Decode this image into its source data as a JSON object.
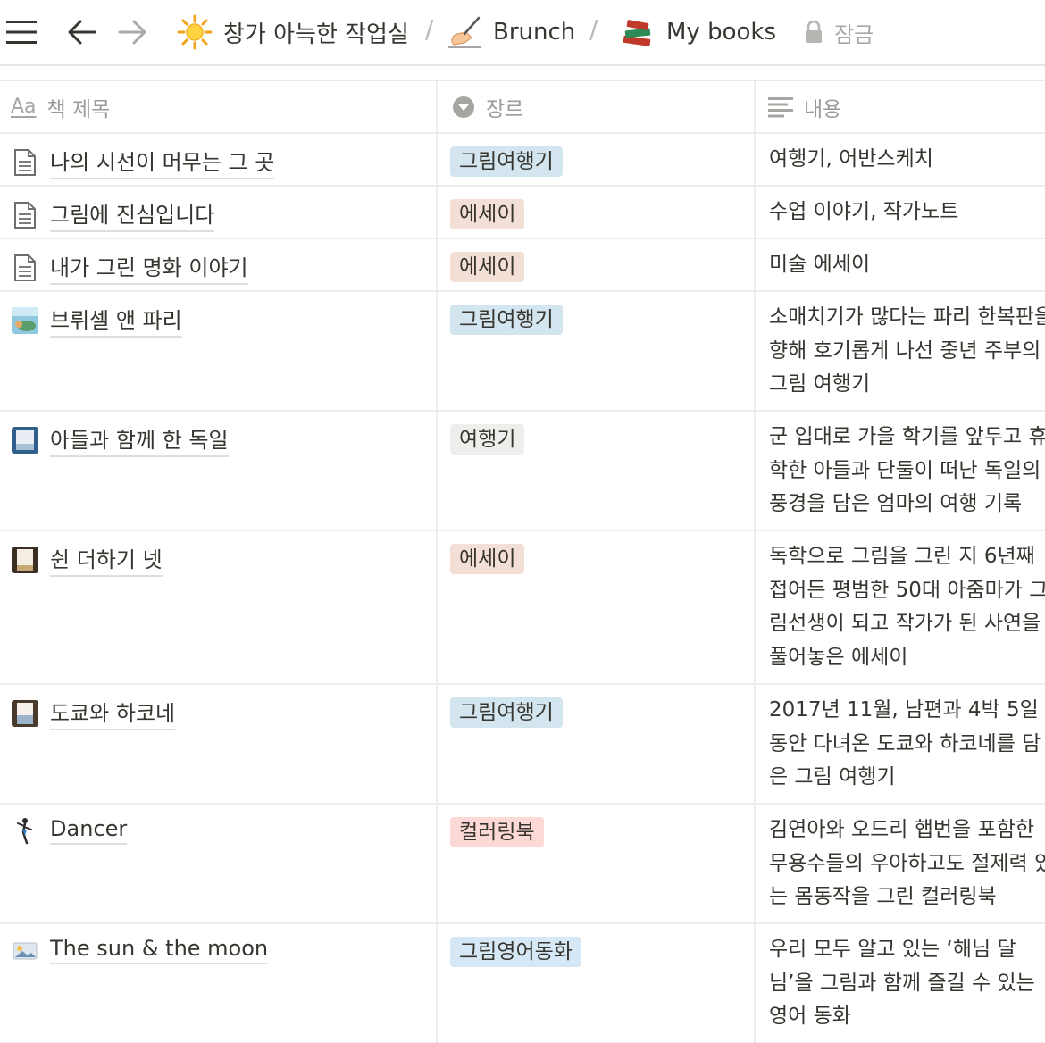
{
  "topbar": {
    "breadcrumbs": [
      {
        "label": "창가 아늑한 작업실",
        "icon": "sun-icon"
      },
      {
        "label": "Brunch",
        "icon": "writing-hand-icon"
      },
      {
        "label": "My books",
        "icon": "books-icon"
      }
    ],
    "separator": "/",
    "lock_label": "잠금"
  },
  "table": {
    "columns": [
      {
        "label": "책 제목",
        "icon": "title-aa-icon",
        "icon_text": "Aa"
      },
      {
        "label": "장르",
        "icon": "select-icon"
      },
      {
        "label": "내용",
        "icon": "text-lines-icon"
      }
    ],
    "rows": [
      {
        "title": "나의 시선이 머무는 그 곳",
        "icon": "document-icon",
        "genre": "그림여행기",
        "desc": "여행기, 어반스케치"
      },
      {
        "title": "그림에 진심입니다",
        "icon": "document-icon",
        "genre": "에세이",
        "desc": "수업 이야기, 작가노트"
      },
      {
        "title": "내가 그린 명화 이야기",
        "icon": "document-icon",
        "genre": "에세이",
        "desc": "미술 에세이"
      },
      {
        "title": "브뤼셀 앤 파리",
        "icon": "book-cover-icon",
        "genre": "그림여행기",
        "desc": "소매치기가 많다는 파리 한복판을\n향해 호기롭게 나선 중년 주부의\n그림 여행기"
      },
      {
        "title": "아들과 함께 한 독일",
        "icon": "book-cover-icon",
        "genre": "여행기",
        "desc": "군 입대로 가을 학기를 앞두고 휴\n학한 아들과 단둘이 떠난 독일의\n풍경을 담은 엄마의 여행 기록"
      },
      {
        "title": "쉰 더하기 넷",
        "icon": "book-cover-icon",
        "genre": "에세이",
        "desc": "독학으로 그림을 그린 지 6년째\n접어든 평범한 50대 아줌마가 그\n림선생이 되고 작가가 된 사연을\n풀어놓은 에세이"
      },
      {
        "title": "도쿄와 하코네",
        "icon": "book-cover-icon",
        "genre": "그림여행기",
        "desc": "2017년 11월, 남편과 4박 5일\n동안 다녀온 도쿄와 하코네를 담\n은 그림 여행기"
      },
      {
        "title": "Dancer",
        "icon": "dancer-icon",
        "genre": "컬러링북",
        "desc": "김연아와 오드리 햅번을 포함한\n무용수들의 우아하고도 절제력 있\n는 몸동작을 그린 컬러링북"
      },
      {
        "title": "The sun & the moon",
        "icon": "picture-icon",
        "genre": "그림영어동화",
        "desc": "우리 모두 알고 있는 ‘해님 달\n님’을 그림과 함께 즐길 수 있는\n영어 동화"
      }
    ]
  },
  "colors": {
    "tag_travel_drawing": "#d3e5ef",
    "tag_essay": "#f4dfd6",
    "tag_travel": "#eeeeec",
    "tag_coloring": "#fcd9d6",
    "tag_english_tale": "#d6e8f5"
  }
}
